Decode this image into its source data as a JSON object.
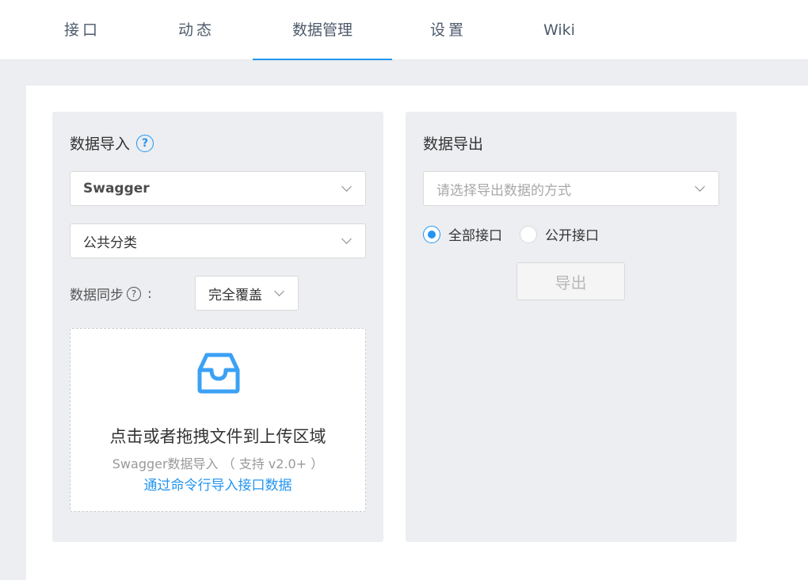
{
  "nav": {
    "tabs": [
      {
        "label": "接口"
      },
      {
        "label": "动态"
      },
      {
        "label": "数据管理",
        "active": true
      },
      {
        "label": "设置"
      },
      {
        "label": "Wiki"
      }
    ]
  },
  "import": {
    "title": "数据导入",
    "help_glyph": "?",
    "format_value": "Swagger",
    "category_value": "公共分类",
    "sync_label": "数据同步",
    "sync_colon": ":",
    "sync_value": "完全覆盖",
    "upload_title": "点击或者拖拽文件到上传区域",
    "upload_hint": "Swagger数据导入 （ 支持 v2.0+ ）",
    "upload_link": "通过命令行导入接口数据"
  },
  "export": {
    "title": "数据导出",
    "method_placeholder": "请选择导出数据的方式",
    "radio_all": "全部接口",
    "radio_public": "公开接口",
    "selected_radio": "全部接口",
    "button_label": "导出"
  },
  "colors": {
    "accent": "#2395f1",
    "panel_bg": "#eceef1"
  },
  "icons": {
    "upload": "inbox-icon",
    "help": "question-circle-icon",
    "dropdown": "chevron-down-icon"
  }
}
